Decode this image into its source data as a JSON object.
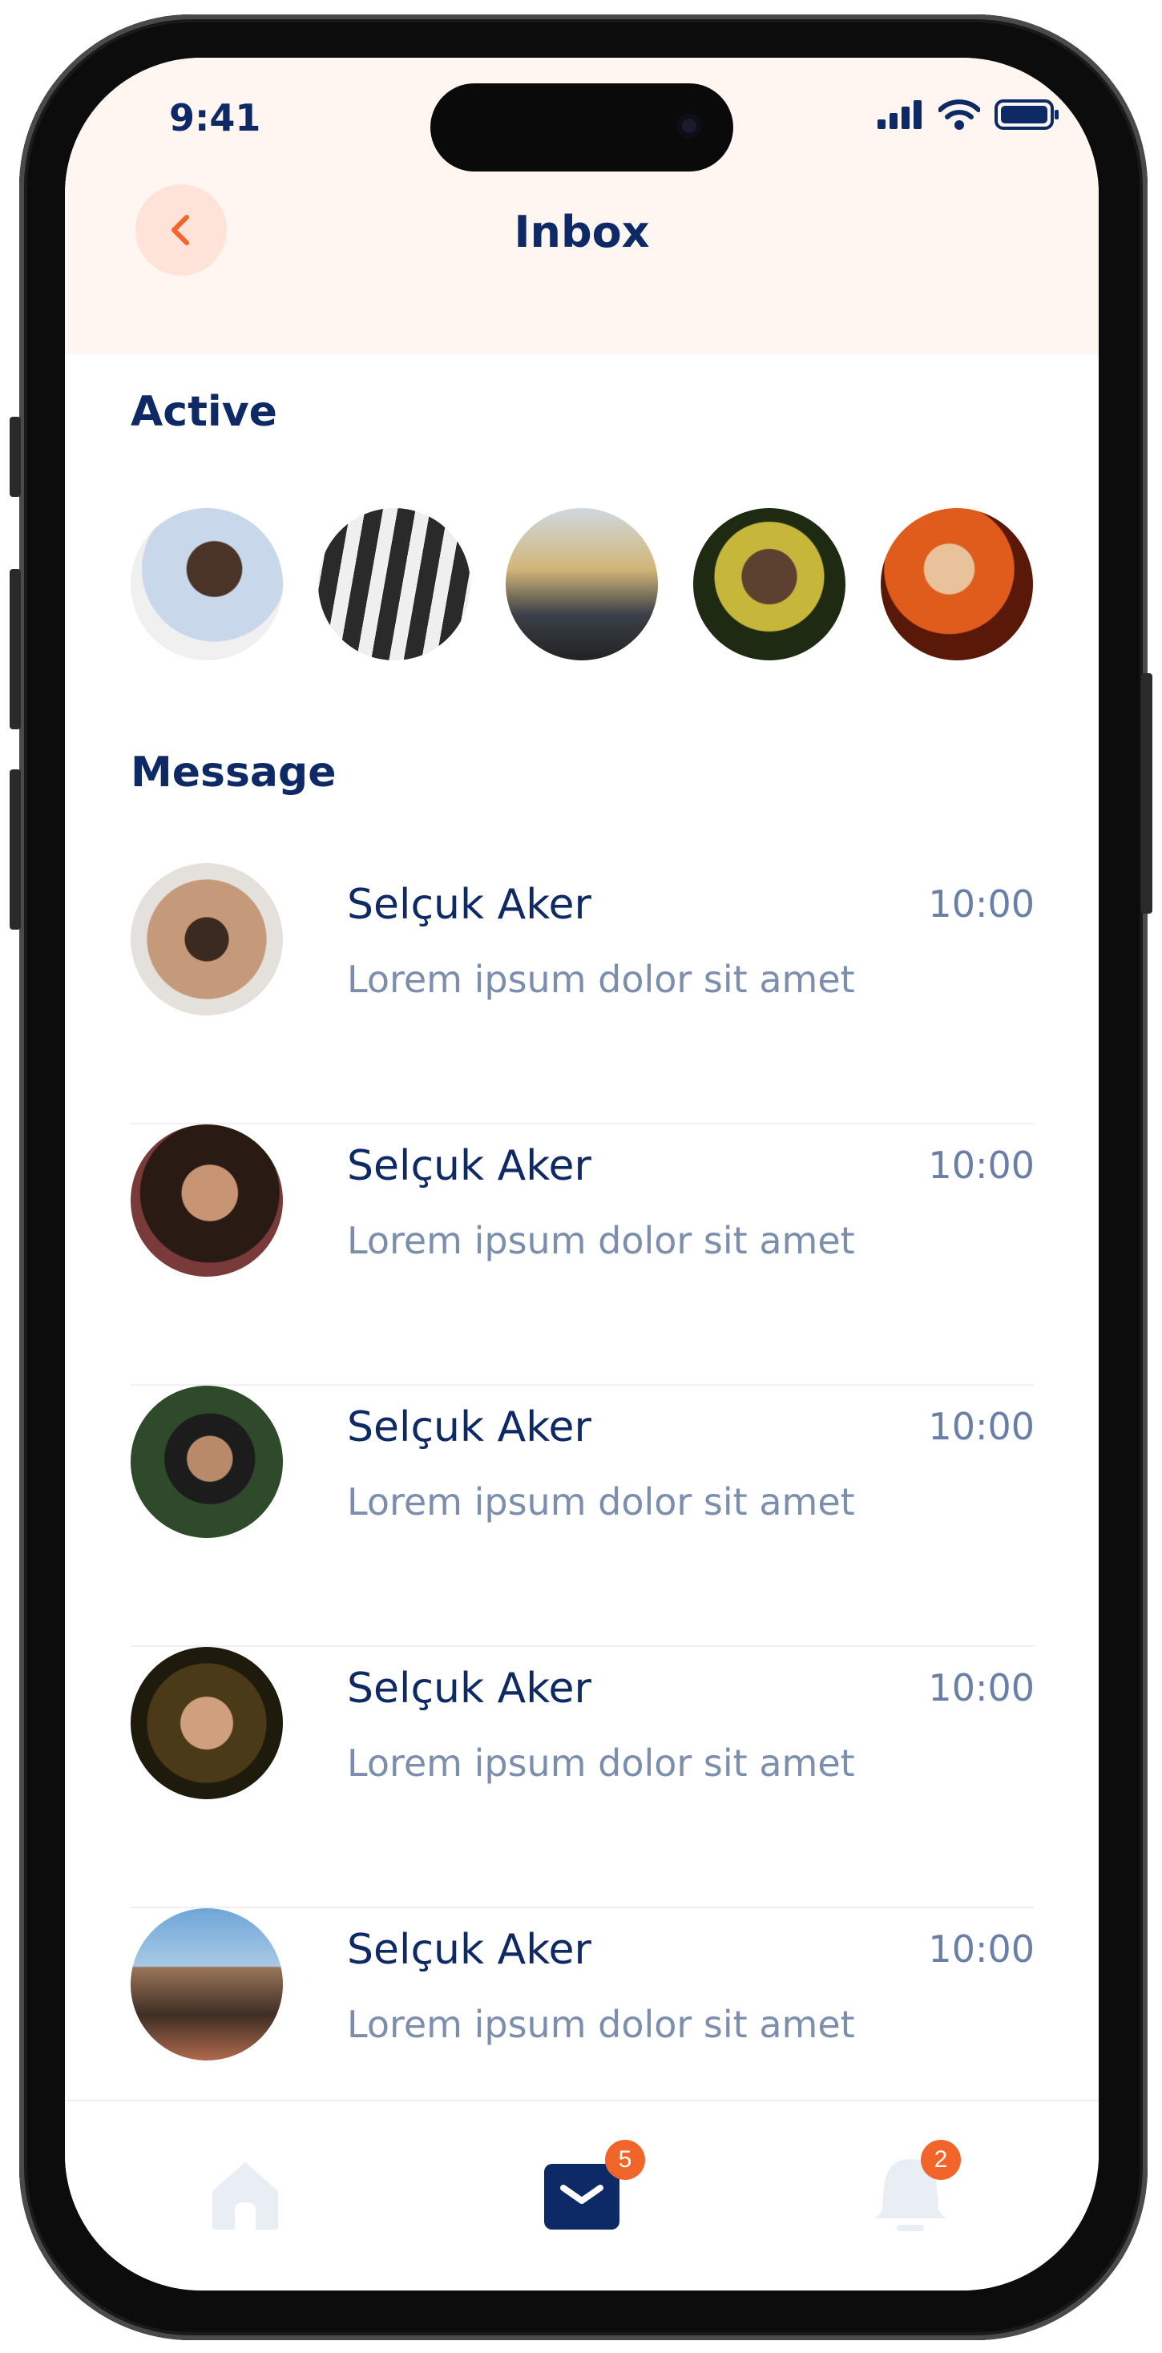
{
  "status_bar": {
    "time": "9:41"
  },
  "header": {
    "title": "Inbox"
  },
  "sections": {
    "active_title": "Active",
    "messages_title": "Message"
  },
  "messages": [
    {
      "name": "Selçuk Aker",
      "time": "10:00",
      "preview": "Lorem ipsum dolor sit amet"
    },
    {
      "name": "Selçuk Aker",
      "time": "10:00",
      "preview": "Lorem ipsum dolor sit amet"
    },
    {
      "name": "Selçuk Aker",
      "time": "10:00",
      "preview": "Lorem ipsum dolor sit amet"
    },
    {
      "name": "Selçuk Aker",
      "time": "10:00",
      "preview": "Lorem ipsum dolor sit amet"
    },
    {
      "name": "Selçuk Aker",
      "time": "10:00",
      "preview": "Lorem ipsum dolor sit amet"
    }
  ],
  "tab_bar": {
    "mail_badge": "5",
    "notifications_badge": "2"
  },
  "colors": {
    "primary": "#0e2a66",
    "accent": "#f1652b",
    "header_bg": "#fff5f1",
    "back_button_bg": "#ffe2d8",
    "muted_text": "#7c8eae",
    "inactive_icon": "#e9edf4"
  },
  "icons": {
    "back": "chevron-left-icon",
    "home": "home-icon",
    "mail": "mail-icon",
    "notifications": "bell-icon"
  }
}
